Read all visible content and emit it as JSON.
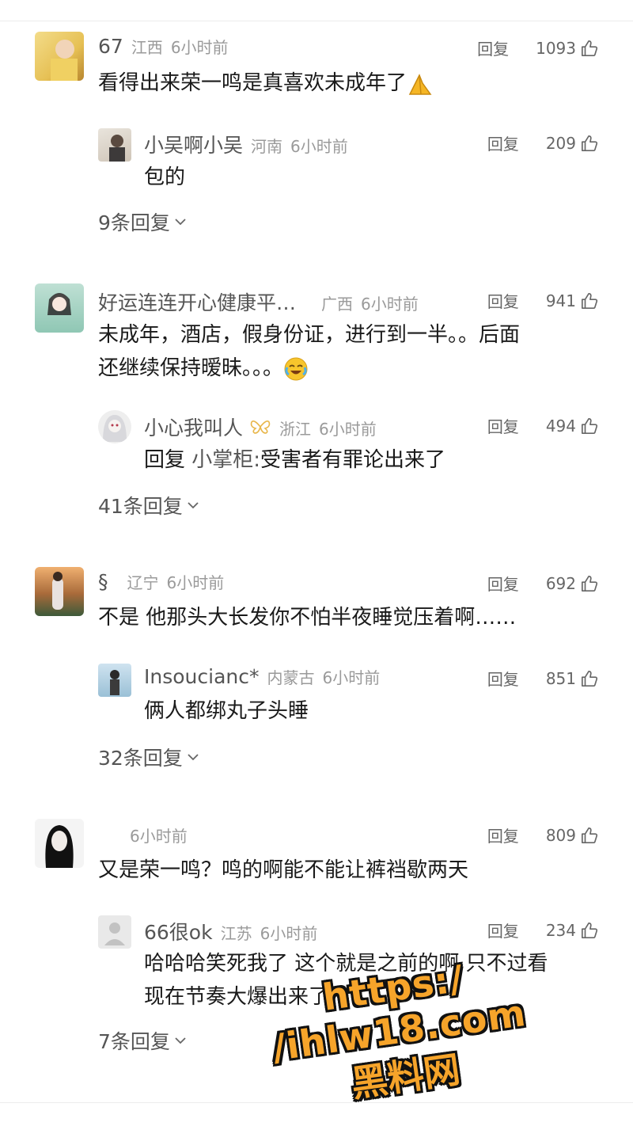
{
  "comments": [
    {
      "user": "67",
      "region": "江西",
      "time": "6小时前",
      "reply_label": "回复",
      "likes": "1093",
      "text": "看得出来荣一鸣是真喜欢未成年了",
      "emoji": "pray-hands-icon",
      "reply": {
        "user": "小吴啊小吴",
        "region": "河南",
        "time": "6小时前",
        "reply_label": "回复",
        "likes": "209",
        "text": "包的"
      },
      "more": "9条回复"
    },
    {
      "user": "好运连连开心健康平…",
      "region": "广西",
      "time": "6小时前",
      "reply_label": "回复",
      "likes": "941",
      "text_line1": "未成年，酒店，假身份证，进行到一半。。后面",
      "text_line2": "还继续保持暧昧。。。",
      "emoji": "laugh-cry-icon",
      "reply": {
        "user": "小心我叫人",
        "region": "浙江",
        "time": "6小时前",
        "reply_label": "回复",
        "likes": "494",
        "prefix": "回复",
        "mention": "小掌柜:",
        "text": "受害者有罪论出来了"
      },
      "more": "41条回复"
    },
    {
      "user": "§",
      "region": "辽宁",
      "time": "6小时前",
      "reply_label": "回复",
      "likes": "692",
      "text": "不是 他那头大长发你不怕半夜睡觉压着啊……",
      "reply": {
        "user": "Insoucianc*",
        "region": "内蒙古",
        "time": "6小时前",
        "reply_label": "回复",
        "likes": "851",
        "text": "俩人都绑丸子头睡"
      },
      "more": "32条回复"
    },
    {
      "user": "",
      "time": "6小时前",
      "reply_label": "回复",
      "likes": "809",
      "text": "又是荣一鸣？鸣的啊能不能让裤裆歇两天",
      "reply": {
        "user": "66很ok",
        "region": "江苏",
        "time": "6小时前",
        "reply_label": "回复",
        "likes": "234",
        "text_line1": "哈哈哈笑死我了 这个就是之前的啊 只不过看",
        "text_line2": "现在节奏大爆出来了"
      },
      "more": "7条回复"
    }
  ],
  "watermark": {
    "url": "https:/ /ihlw18.com",
    "name": "黑料网"
  },
  "colors": {
    "watermark": "#f6a42a",
    "text": "#1a1a1a",
    "meta": "#9a9a9a"
  }
}
